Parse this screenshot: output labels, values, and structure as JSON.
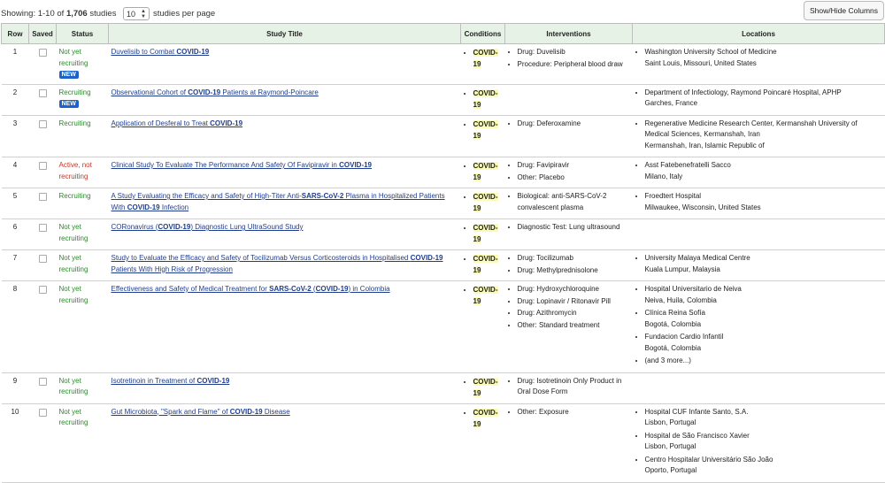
{
  "toolbar": {
    "showing_prefix": "Showing: 1-10 of ",
    "total": "1,706",
    "showing_suffix": " studies",
    "per_page_value": "10",
    "per_page_label": "studies per page",
    "show_hide_label": "Show/Hide Columns"
  },
  "columns": [
    "Row",
    "Saved",
    "Status",
    "Study Title",
    "Conditions",
    "Interventions",
    "Locations"
  ],
  "rows": [
    {
      "row": "1",
      "status": "Not yet recruiting",
      "status_color": "#2a8a2a",
      "new": "NEW",
      "title": [
        {
          "t": "Duvelisib to Combat "
        },
        {
          "t": "COVID-19",
          "b": true
        }
      ],
      "conditions": [
        "COVID-19"
      ],
      "interventions": [
        "Drug: Duvelisib",
        "Procedure: Peripheral blood draw"
      ],
      "locations": [
        {
          "name": "Washington University School of Medicine",
          "city": "Saint Louis, Missouri, United States"
        }
      ]
    },
    {
      "row": "2",
      "status": "Recruiting",
      "status_color": "#2a8a2a",
      "new": "NEW",
      "title": [
        {
          "t": "Observational Cohort of "
        },
        {
          "t": "COVID-19",
          "b": true
        },
        {
          "t": " Patients at Raymond-Poincare"
        }
      ],
      "conditions": [
        "COVID-19"
      ],
      "interventions": [],
      "locations": [
        {
          "name": "Department of Infectiology, Raymond Poincaré Hospital, APHP",
          "city": "Garches, France"
        }
      ]
    },
    {
      "row": "3",
      "status": "Recruiting",
      "status_color": "#2a8a2a",
      "title": [
        {
          "t": "Application of Desferal to Treat "
        },
        {
          "t": "COVID-19",
          "b": true
        }
      ],
      "conditions": [
        "COVID-19"
      ],
      "interventions": [
        "Drug: Deferoxamine"
      ],
      "locations": [
        {
          "name": "Regenerative Medicine Research Center, Kermanshah University of Medical Sciences, Kermanshah, Iran",
          "city": "Kermanshah, Iran, Islamic Republic of"
        }
      ]
    },
    {
      "row": "4",
      "status": "Active, not recruiting",
      "status_color": "#c0392b",
      "title": [
        {
          "t": "Clinical Study To Evaluate The Performance And Safety Of Favipiravir in "
        },
        {
          "t": "COVID-19",
          "b": true
        }
      ],
      "conditions": [
        "COVID-19"
      ],
      "interventions": [
        "Drug: Favipiravir",
        "Other: Placebo"
      ],
      "locations": [
        {
          "name": "Asst Fatebenefratelli Sacco",
          "city": "Milano, Italy"
        }
      ]
    },
    {
      "row": "5",
      "status": "Recruiting",
      "status_color": "#2a8a2a",
      "title": [
        {
          "t": "A Study Evaluating the Efficacy and Safety of High-Titer Anti-"
        },
        {
          "t": "SARS-CoV-2",
          "b": true
        },
        {
          "t": " Plasma in Hospitalized Patients With "
        },
        {
          "t": "COVID-19",
          "b": true
        },
        {
          "t": " Infection"
        }
      ],
      "conditions": [
        "COVID-19"
      ],
      "interventions": [
        "Biological: anti-SARS-CoV-2 convalescent plasma"
      ],
      "locations": [
        {
          "name": "Froedtert Hospital",
          "city": "Milwaukee, Wisconsin, United States"
        }
      ]
    },
    {
      "row": "6",
      "status": "Not yet recruiting",
      "status_color": "#2a8a2a",
      "title": [
        {
          "t": "CORonavirus ("
        },
        {
          "t": "COVID-19",
          "b": true
        },
        {
          "t": ") Diagnostic Lung UltraSound Study"
        }
      ],
      "conditions": [
        "COVID-19"
      ],
      "interventions": [
        "Diagnostic Test: Lung ultrasound"
      ],
      "locations": []
    },
    {
      "row": "7",
      "status": "Not yet recruiting",
      "status_color": "#2a8a2a",
      "title": [
        {
          "t": "Study to Evaluate the Efficacy and Safety of Tocilizumab Versus Corticosteroids in Hospitalised "
        },
        {
          "t": "COVID-19",
          "b": true
        },
        {
          "t": " Patients With High Risk of Progression"
        }
      ],
      "conditions": [
        "COVID-19"
      ],
      "interventions": [
        "Drug: Tocilizumab",
        "Drug: Methylprednisolone"
      ],
      "locations": [
        {
          "name": "University Malaya Medical Centre",
          "city": "Kuala Lumpur, Malaysia"
        }
      ]
    },
    {
      "row": "8",
      "status": "Not yet recruiting",
      "status_color": "#2a8a2a",
      "title": [
        {
          "t": "Effectiveness and Safety of Medical Treatment for "
        },
        {
          "t": "SARS-CoV-2",
          "b": true
        },
        {
          "t": " ("
        },
        {
          "t": "COVID-19",
          "b": true
        },
        {
          "t": ") in Colombia"
        }
      ],
      "conditions": [
        "COVID-19"
      ],
      "interventions": [
        "Drug: Hydroxychloroquine",
        "Drug: Lopinavir / Ritonavir Pill",
        "Drug: Azithromycin",
        "Other: Standard treatment"
      ],
      "locations": [
        {
          "name": "Hospital Universitario de Neiva",
          "city": "Neiva, Huila, Colombia"
        },
        {
          "name": "Clínica Reina Sofía",
          "city": "Bogotá, Colombia"
        },
        {
          "name": "Fundacion Cardio Infantil",
          "city": "Bogotá, Colombia"
        },
        {
          "name": "(and 3 more...)",
          "city": ""
        }
      ]
    },
    {
      "row": "9",
      "status": "Not yet recruiting",
      "status_color": "#2a8a2a",
      "title": [
        {
          "t": "Isotretinoin in Treatment of "
        },
        {
          "t": "COVID-19",
          "b": true
        }
      ],
      "conditions": [
        "COVID-19"
      ],
      "interventions": [
        "Drug: Isotretinoin Only Product in Oral Dose Form"
      ],
      "locations": []
    },
    {
      "row": "10",
      "status": "Not yet recruiting",
      "status_color": "#2a8a2a",
      "title": [
        {
          "t": "Gut Microbiota, \"Spark and Flame\" of "
        },
        {
          "t": "COVID-19",
          "b": true
        },
        {
          "t": " Disease"
        }
      ],
      "conditions": [
        "COVID-19"
      ],
      "interventions": [
        "Other: Exposure"
      ],
      "locations": [
        {
          "name": "Hospital CUF Infante Santo, S.A.",
          "city": "Lisbon, Portugal"
        },
        {
          "name": "Hospital de São Francisco Xavier",
          "city": "Lisbon, Portugal"
        },
        {
          "name": "Centro Hospitalar Universitário São João",
          "city": "Oporto, Portugal"
        }
      ]
    }
  ]
}
